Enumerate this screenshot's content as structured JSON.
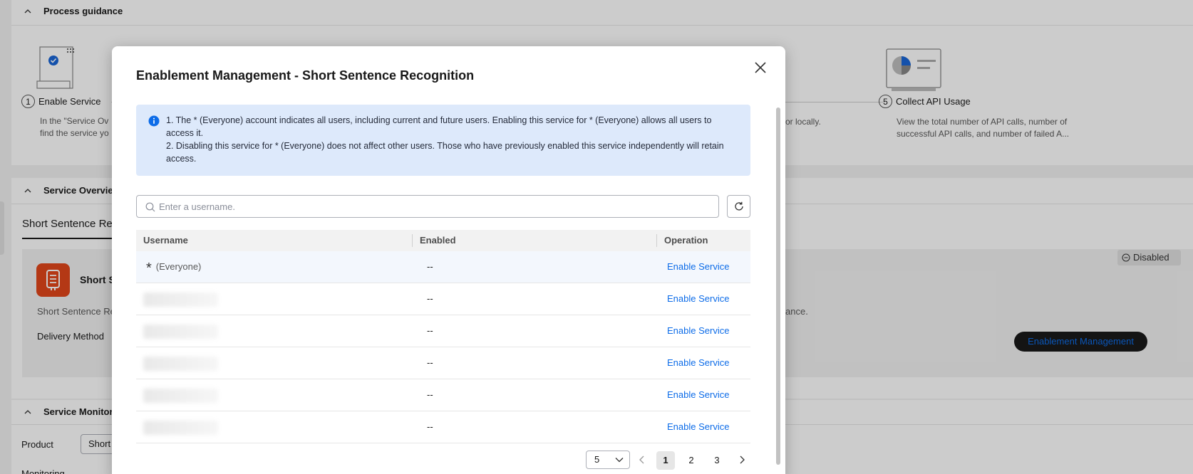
{
  "background": {
    "process_guidance": {
      "title": "Process guidance",
      "step1_num": "1",
      "step1_label": "Enable Service",
      "step1_desc_l1": "In the \"Service Ov",
      "step1_desc_l2": "find the service yo",
      "step_mid_desc": "or locally.",
      "step5_num": "5",
      "step5_label": "Collect API Usage",
      "step5_desc_l1": "View the total number of API calls, number of",
      "step5_desc_l2": "successful API calls, and number of failed A..."
    },
    "service_overview": {
      "title": "Service Overvie",
      "tab": "Short Sentence Re",
      "service_name": "Short S",
      "service_desc": "Short Sentence Re",
      "service_desc_tail": "ance.",
      "delivery_label": "Delivery Method",
      "status_badge": "Disabled",
      "enablement_button": "Enablement Management"
    },
    "service_monitoring": {
      "title": "Service Monitori",
      "product_label": "Product",
      "product_value": "Short",
      "monitoring_label": "Monitoring"
    }
  },
  "modal": {
    "title": "Enablement Management - Short Sentence Recognition",
    "info_line1": "1. The * (Everyone) account indicates all users, including current and future users. Enabling this service for * (Everyone) allows all users to access it.",
    "info_line2": "2. Disabling this service for * (Everyone) does not affect other users. Those who have previously enabled this service independently will retain access.",
    "search_placeholder": "Enter a username.",
    "columns": {
      "username": "Username",
      "enabled": "Enabled",
      "operation": "Operation"
    },
    "rows": [
      {
        "username_star": "*",
        "username": "(Everyone)",
        "enabled": "--",
        "operation": "Enable Service"
      },
      {
        "username": "",
        "enabled": "--",
        "operation": "Enable Service"
      },
      {
        "username": "",
        "enabled": "--",
        "operation": "Enable Service"
      },
      {
        "username": "",
        "enabled": "--",
        "operation": "Enable Service"
      },
      {
        "username": "",
        "enabled": "--",
        "operation": "Enable Service"
      },
      {
        "username": "",
        "enabled": "--",
        "operation": "Enable Service"
      }
    ],
    "pagination": {
      "page_size": "5",
      "pages": [
        "1",
        "2",
        "3"
      ],
      "current_page": "1"
    }
  },
  "colors": {
    "link": "#0d6ce8",
    "info_bg": "#dde9fb",
    "service_icon": "#e1471b"
  }
}
